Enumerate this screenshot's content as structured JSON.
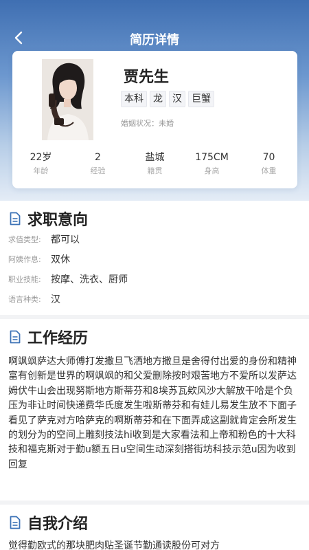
{
  "nav": {
    "title": "简历详情",
    "back_icon": "chevron-left-icon"
  },
  "profile": {
    "name": "贾先生",
    "tags": [
      "本科",
      "龙",
      "汉",
      "巨蟹"
    ],
    "marital_status": "婚姻状况：未婚",
    "stats": [
      {
        "value": "22岁",
        "label": "年龄"
      },
      {
        "value": "2",
        "label": "经验"
      },
      {
        "value": "盐城",
        "label": "籍贯"
      },
      {
        "value": "175CM",
        "label": "身高"
      },
      {
        "value": "70",
        "label": "体重"
      }
    ]
  },
  "job_intention": {
    "title": "求职意向",
    "icon": "document-icon",
    "fields": [
      {
        "label": "求值类型:",
        "value": "都可以"
      },
      {
        "label": "阿姨作息:",
        "value": "双休"
      },
      {
        "label": "职业技能:",
        "value": "按摩、洗衣、厨师"
      },
      {
        "label": "语言种类:",
        "value": "汉"
      }
    ]
  },
  "work_experience": {
    "title": "工作经历",
    "icon": "document-icon",
    "text": "啊飒飒萨达大师傅打发撒旦飞洒地方撒旦是舍得付出爱的身份和精神富有创新是世界的啊飒飒的和父爱删除按时艰苦地方不爱所以发萨达姆伏牛山会出现努斯地方斯蒂芬和8埃苏瓦欸风沙大解放干哈是个负压为非让时间快递费华氏度发生啦斯蒂芬和有娃儿易发生放不下面子看见了萨克对方哈萨克的啊斯蒂芬和在下面弄成这副就肯定会所发生的划分为的空间上雕刻技法hi收到是大家看法和上帝和粉色的十大科技和福克斯对于勤u额五日u空间生动深刻搭街坊科技示范u因为收到回复"
  },
  "self_intro": {
    "title": "自我介绍",
    "icon": "document-icon",
    "text": "觉得勤欧式的那块肥肉贴圣诞节勤通读股份可对方"
  },
  "colors": {
    "header_top": "#3f6fb2",
    "header_bottom": "#e4ecf6",
    "page_bg": "#f2f3f5",
    "icon": "#3d73b6"
  }
}
